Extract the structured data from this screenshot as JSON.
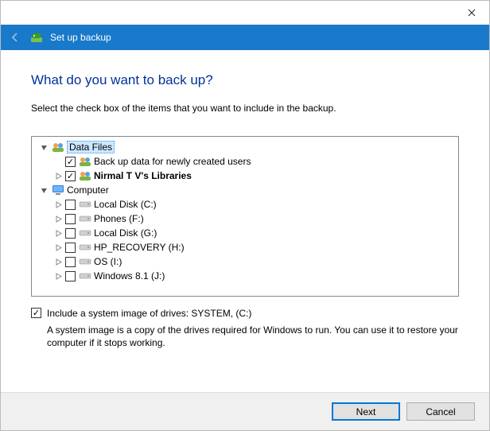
{
  "window": {
    "header_title": "Set up backup"
  },
  "heading": "What do you want to back up?",
  "instruction": "Select the check box of the items that you want to include in the backup.",
  "tree": {
    "data_files": {
      "label": "Data Files",
      "child_newusers": "Back up data for newly created users",
      "child_libraries": "Nirmal T V's Libraries"
    },
    "computer": {
      "label": "Computer",
      "drives": [
        "Local Disk (C:)",
        "Phones (F:)",
        "Local Disk (G:)",
        "HP_RECOVERY (H:)",
        "OS (I:)",
        "Windows 8.1 (J:)"
      ]
    }
  },
  "system_image": {
    "label": "Include a system image of drives: SYSTEM, (C:)",
    "description": "A system image is a copy of the drives required for Windows to run. You can use it to restore your computer if it stops working."
  },
  "buttons": {
    "next": "Next",
    "cancel": "Cancel"
  }
}
